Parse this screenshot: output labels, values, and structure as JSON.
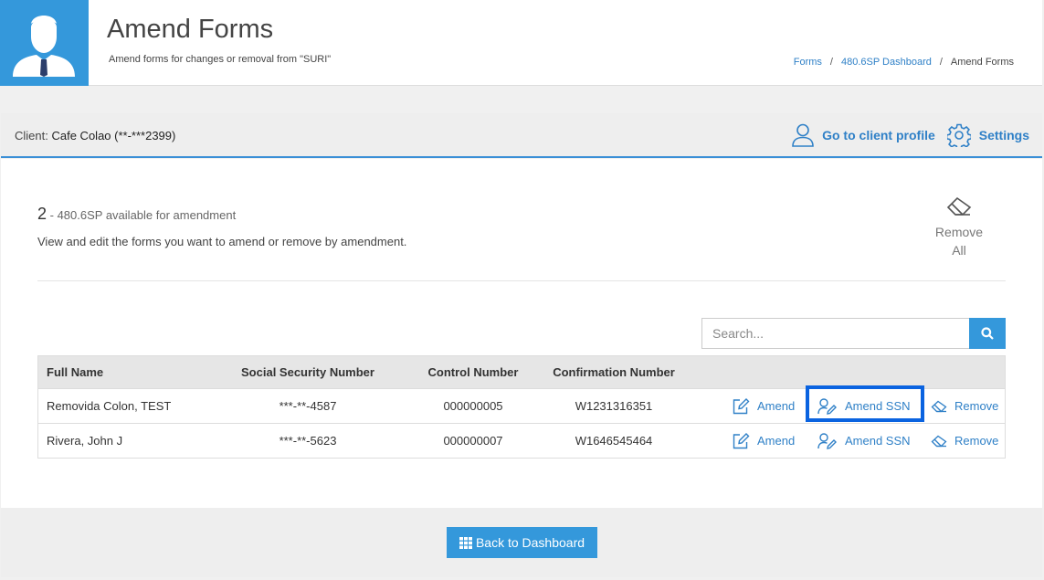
{
  "header": {
    "title": "Amend Forms",
    "subtitle": "Amend forms for changes or removal from \"SURI\"",
    "breadcrumb": [
      {
        "label": "Forms"
      },
      {
        "label": "480.6SP Dashboard"
      },
      {
        "label": "Amend Forms"
      }
    ]
  },
  "client_bar": {
    "label": "Client:",
    "name": "Cafe Colao (**-***2399)",
    "profile_link": "Go to client profile",
    "settings_link": "Settings"
  },
  "summary": {
    "count": "2",
    "count_text": "- 480.6SP available for amendment",
    "description": "View and edit the forms you want to amend or remove by amendment.",
    "remove_all_line1": "Remove",
    "remove_all_line2": "All"
  },
  "search": {
    "placeholder": "Search..."
  },
  "table": {
    "headers": [
      "Full Name",
      "Social Security Number",
      "Control Number",
      "Confirmation Number"
    ],
    "rows": [
      {
        "name": "Removida Colon, TEST",
        "ssn": "***-**-4587",
        "control": "000000005",
        "confirmation": "W1231316351"
      },
      {
        "name": "Rivera, John J",
        "ssn": "***-**-5623",
        "control": "000000007",
        "confirmation": "W1646545464"
      }
    ],
    "actions": {
      "amend": "Amend",
      "amend_ssn": "Amend SSN",
      "remove": "Remove"
    }
  },
  "footer": {
    "back_label": "Back to Dashboard"
  },
  "colors": {
    "accent": "#3498db",
    "link": "#2f80c7",
    "highlight": "#0a63e0"
  },
  "icons": [
    "user-avatar-icon",
    "user-icon",
    "gear-icon",
    "eraser-icon",
    "search-icon",
    "edit-icon",
    "user-edit-icon",
    "grid-icon"
  ]
}
